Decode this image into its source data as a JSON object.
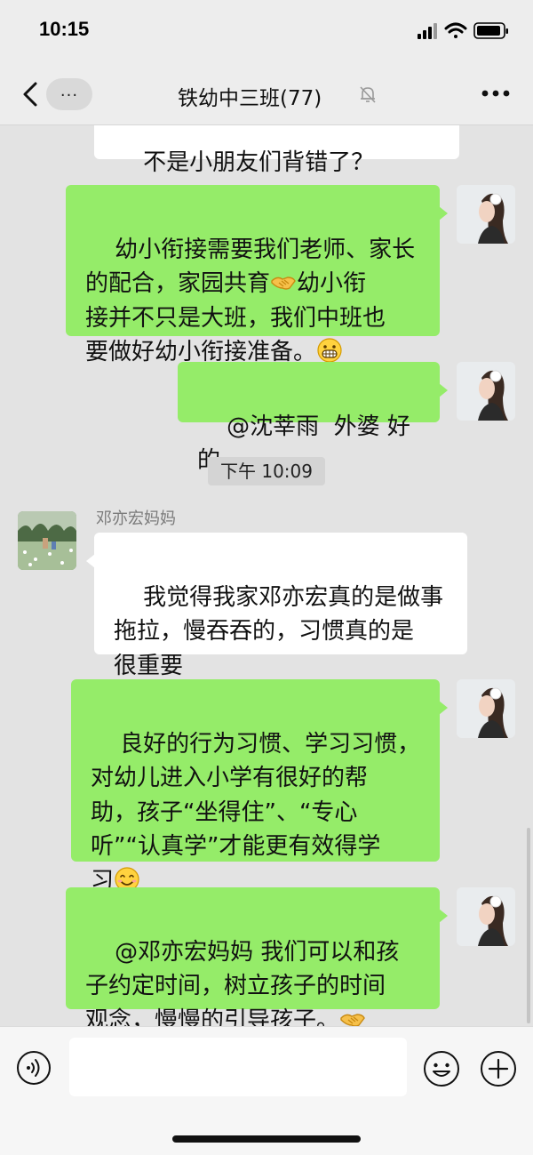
{
  "status_bar": {
    "time": "10:15"
  },
  "header": {
    "more_label": "...",
    "title": "铁幼中三班(77)"
  },
  "messages": {
    "m0": "不是小朋友们背错了？",
    "m1_a": "幼小衔接需要我们老师、家长\n的配合，家园共育",
    "m1_b": "幼小衔\n接并不只是大班，我们中班也\n要做好幼小衔接准备。",
    "m2": "@沈莘雨  外婆 好的",
    "time_chip": "下午 10:09",
    "sender_name": "邓亦宏妈妈",
    "m3": "我觉得我家邓亦宏真的是做事\n拖拉，慢吞吞的，习惯真的是\n很重要",
    "m4": "良好的行为习惯、学习习惯，\n对幼儿进入小学有很好的帮\n助，孩子“坐得住”、“专心\n听”“认真学”才能更有效得学\n习",
    "m5": "@邓亦宏妈妈 我们可以和孩\n子约定时间，树立孩子的时间\n观念，慢慢的引导孩子。"
  },
  "icons": {
    "back": "chevron-left-icon",
    "mute": "bell-slash-icon",
    "menu": "more-dots-icon",
    "voice": "voice-icon",
    "emoji": "smile-icon",
    "add": "plus-icon",
    "handshake": "handshake-emoji",
    "grin": "grin-emoji",
    "smile": "smile-emoji"
  },
  "colors": {
    "own_bubble": "#95ec69",
    "other_bubble": "#ffffff",
    "chat_background": "#e3e3e3",
    "bar_background": "#ededed"
  }
}
